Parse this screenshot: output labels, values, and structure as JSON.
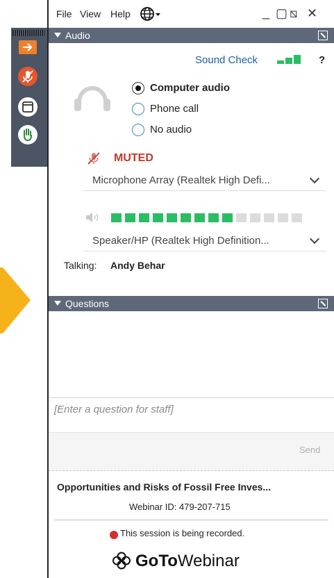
{
  "menu": {
    "file": "File",
    "view": "View",
    "help": "Help",
    "language_icon": "globe-icon"
  },
  "window_controls": {
    "minimize": "_",
    "restore": "▢",
    "popout": "⧅",
    "close": "✕"
  },
  "side_toolbar": {
    "items": [
      {
        "icon": "arrow-right-icon",
        "color": "#f07f2b"
      },
      {
        "icon": "microphone-muted-icon",
        "color": "#e4572e"
      },
      {
        "icon": "window-icon",
        "color": "#ffffff"
      },
      {
        "icon": "raise-hand-icon",
        "color": "#ffffff"
      }
    ]
  },
  "audio_panel": {
    "title": "Audio",
    "sound_check": "Sound Check",
    "help": "?",
    "options": [
      {
        "label": "Computer audio",
        "selected": true
      },
      {
        "label": "Phone call",
        "selected": false
      },
      {
        "label": "No audio",
        "selected": false
      }
    ],
    "muted_label": "MUTED",
    "microphone_device": "Microphone Array (Realtek High Defi...",
    "speaker_level_active": 9,
    "speaker_level_total": 14,
    "speaker_device": "Speaker/HP (Realtek High Definition...",
    "talking_label": "Talking:",
    "talking_name": "Andy Behar"
  },
  "questions_panel": {
    "title": "Questions",
    "input_placeholder": "[Enter a question for staff]",
    "send_label": "Send"
  },
  "footer": {
    "webinar_title": "Opportunities and Risks of Fossil Free Inves...",
    "webinar_id": "Webinar ID: 479-207-715",
    "recording_notice": "This session is being recorded.",
    "brand_goto": "GoTo",
    "brand_webinar": "Webinar"
  },
  "colors": {
    "panel_header": "#5f6878",
    "muted_red": "#c0392b",
    "link_blue": "#1f5fa8",
    "meter_green": "#2bbd63",
    "meter_gray": "#dcdcdc",
    "accent_orange": "#f07f2b",
    "callout_yellow": "#f5b21b"
  }
}
